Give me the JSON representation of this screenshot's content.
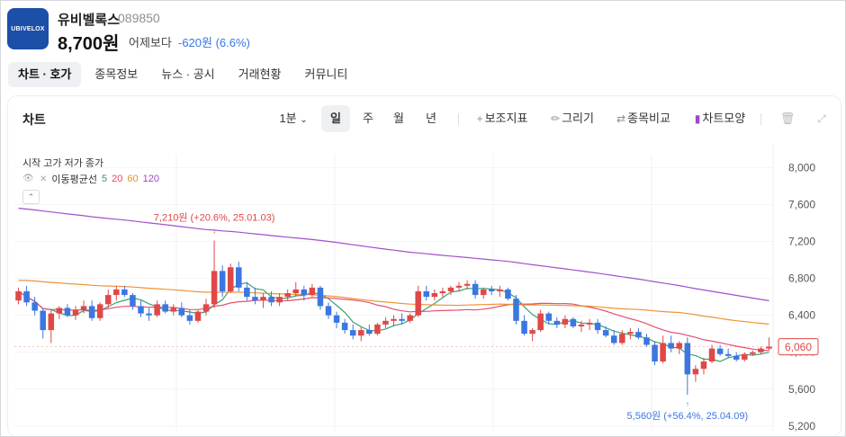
{
  "header": {
    "logo_text": "UBIVELOX",
    "name": "유비벨록스",
    "code": "089850",
    "price": "8,700원",
    "vs_label": "어제보다",
    "change": "-620원 (6.6%)",
    "colors": {
      "down": "#3b77e0",
      "up": "#e04848",
      "brand": "#1b4fa8"
    }
  },
  "tabs": [
    {
      "label": "차트 · 호가",
      "active": true
    },
    {
      "label": "종목정보"
    },
    {
      "label": "뉴스 · 공시"
    },
    {
      "label": "거래현황"
    },
    {
      "label": "커뮤니티"
    }
  ],
  "panel": {
    "title": "차트",
    "interval": "1분",
    "periods": [
      "일",
      "주",
      "월",
      "년"
    ],
    "active_period": "일",
    "tools": [
      "보조지표",
      "그리기",
      "종목비교",
      "차트모양"
    ],
    "legend_ohlc": "시작 고가 저가 종가",
    "ma_label": "이동평균선",
    "ma_periods": [
      {
        "label": "5",
        "color": "#2e9b6b"
      },
      {
        "label": "20",
        "color": "#e0486a"
      },
      {
        "label": "60",
        "color": "#ee8e2a"
      },
      {
        "label": "120",
        "color": "#9b47c8"
      }
    ],
    "collapse_icon": "chevron-up-icon"
  },
  "chart_data": {
    "type": "candlestick",
    "y_ticks": [
      "8,000",
      "7,600",
      "7,200",
      "6,800",
      "6,400",
      "6,000",
      "5,600",
      "5,200"
    ],
    "ylim": [
      5150,
      8150
    ],
    "current_price_label": "6,060",
    "current_price": 6060,
    "high_annotation": "7,210원 (+20.6%, 25.01.03)",
    "low_annotation": "5,560원 (+56.4%, 25.04.09)",
    "candles": [
      [
        6560,
        6700,
        6520,
        6660
      ],
      [
        6660,
        6720,
        6500,
        6540
      ],
      [
        6540,
        6600,
        6400,
        6450
      ],
      [
        6450,
        6480,
        6150,
        6240
      ],
      [
        6240,
        6460,
        6100,
        6420
      ],
      [
        6420,
        6500,
        6360,
        6480
      ],
      [
        6480,
        6520,
        6380,
        6400
      ],
      [
        6400,
        6500,
        6350,
        6460
      ],
      [
        6460,
        6560,
        6420,
        6500
      ],
      [
        6500,
        6560,
        6340,
        6370
      ],
      [
        6370,
        6540,
        6340,
        6520
      ],
      [
        6520,
        6680,
        6480,
        6620
      ],
      [
        6620,
        6720,
        6560,
        6680
      ],
      [
        6680,
        6720,
        6600,
        6620
      ],
      [
        6620,
        6640,
        6460,
        6500
      ],
      [
        6500,
        6560,
        6380,
        6420
      ],
      [
        6420,
        6480,
        6340,
        6400
      ],
      [
        6400,
        6560,
        6380,
        6520
      ],
      [
        6520,
        6560,
        6420,
        6440
      ],
      [
        6440,
        6520,
        6400,
        6480
      ],
      [
        6480,
        6540,
        6380,
        6400
      ],
      [
        6400,
        6460,
        6300,
        6340
      ],
      [
        6340,
        6460,
        6320,
        6440
      ],
      [
        6440,
        6580,
        6400,
        6520
      ],
      [
        6520,
        7210,
        6480,
        6880
      ],
      [
        6880,
        6940,
        6600,
        6660
      ],
      [
        6660,
        6960,
        6640,
        6920
      ],
      [
        6920,
        6980,
        6660,
        6700
      ],
      [
        6700,
        6760,
        6560,
        6600
      ],
      [
        6600,
        6700,
        6520,
        6560
      ],
      [
        6560,
        6640,
        6480,
        6600
      ],
      [
        6600,
        6660,
        6500,
        6540
      ],
      [
        6540,
        6640,
        6500,
        6600
      ],
      [
        6600,
        6680,
        6560,
        6640
      ],
      [
        6640,
        6760,
        6600,
        6680
      ],
      [
        6680,
        6720,
        6560,
        6620
      ],
      [
        6620,
        6740,
        6600,
        6700
      ],
      [
        6700,
        6720,
        6460,
        6500
      ],
      [
        6500,
        6540,
        6360,
        6400
      ],
      [
        6400,
        6440,
        6260,
        6320
      ],
      [
        6320,
        6360,
        6200,
        6240
      ],
      [
        6240,
        6300,
        6140,
        6180
      ],
      [
        6180,
        6280,
        6120,
        6240
      ],
      [
        6240,
        6300,
        6180,
        6200
      ],
      [
        6200,
        6320,
        6180,
        6300
      ],
      [
        6300,
        6380,
        6260,
        6340
      ],
      [
        6340,
        6400,
        6280,
        6360
      ],
      [
        6360,
        6420,
        6300,
        6340
      ],
      [
        6340,
        6420,
        6320,
        6400
      ],
      [
        6400,
        6720,
        6380,
        6660
      ],
      [
        6660,
        6720,
        6560,
        6600
      ],
      [
        6600,
        6680,
        6560,
        6640
      ],
      [
        6640,
        6700,
        6600,
        6660
      ],
      [
        6660,
        6720,
        6620,
        6700
      ],
      [
        6700,
        6760,
        6660,
        6720
      ],
      [
        6720,
        6780,
        6680,
        6740
      ],
      [
        6740,
        6780,
        6580,
        6620
      ],
      [
        6620,
        6700,
        6580,
        6680
      ],
      [
        6680,
        6720,
        6620,
        6660
      ],
      [
        6660,
        6720,
        6600,
        6680
      ],
      [
        6680,
        6700,
        6560,
        6580
      ],
      [
        6580,
        6620,
        6300,
        6340
      ],
      [
        6340,
        6400,
        6180,
        6200
      ],
      [
        6200,
        6260,
        6120,
        6240
      ],
      [
        6240,
        6460,
        6220,
        6420
      ],
      [
        6420,
        6440,
        6300,
        6340
      ],
      [
        6340,
        6380,
        6260,
        6300
      ],
      [
        6300,
        6400,
        6260,
        6360
      ],
      [
        6360,
        6380,
        6260,
        6280
      ],
      [
        6280,
        6340,
        6220,
        6300
      ],
      [
        6300,
        6360,
        6240,
        6320
      ],
      [
        6320,
        6360,
        6200,
        6240
      ],
      [
        6240,
        6280,
        6160,
        6180
      ],
      [
        6180,
        6240,
        6080,
        6100
      ],
      [
        6100,
        6240,
        6080,
        6200
      ],
      [
        6200,
        6260,
        6140,
        6220
      ],
      [
        6220,
        6260,
        6140,
        6160
      ],
      [
        6160,
        6200,
        6060,
        6080
      ],
      [
        6080,
        6120,
        5860,
        5900
      ],
      [
        5900,
        6180,
        5880,
        6100
      ],
      [
        6100,
        6180,
        6000,
        6040
      ],
      [
        6040,
        6120,
        5980,
        6100
      ],
      [
        6100,
        6160,
        5540,
        5760
      ],
      [
        5760,
        5860,
        5680,
        5820
      ],
      [
        5820,
        5940,
        5760,
        5900
      ],
      [
        5900,
        6080,
        5880,
        6040
      ],
      [
        6040,
        6080,
        5960,
        5980
      ],
      [
        5980,
        6040,
        5940,
        5960
      ],
      [
        5960,
        6000,
        5900,
        5920
      ],
      [
        5920,
        6000,
        5900,
        5980
      ],
      [
        5980,
        6020,
        5960,
        6000
      ],
      [
        6000,
        6060,
        5980,
        6040
      ],
      [
        6040,
        6160,
        6020,
        6060
      ]
    ]
  }
}
